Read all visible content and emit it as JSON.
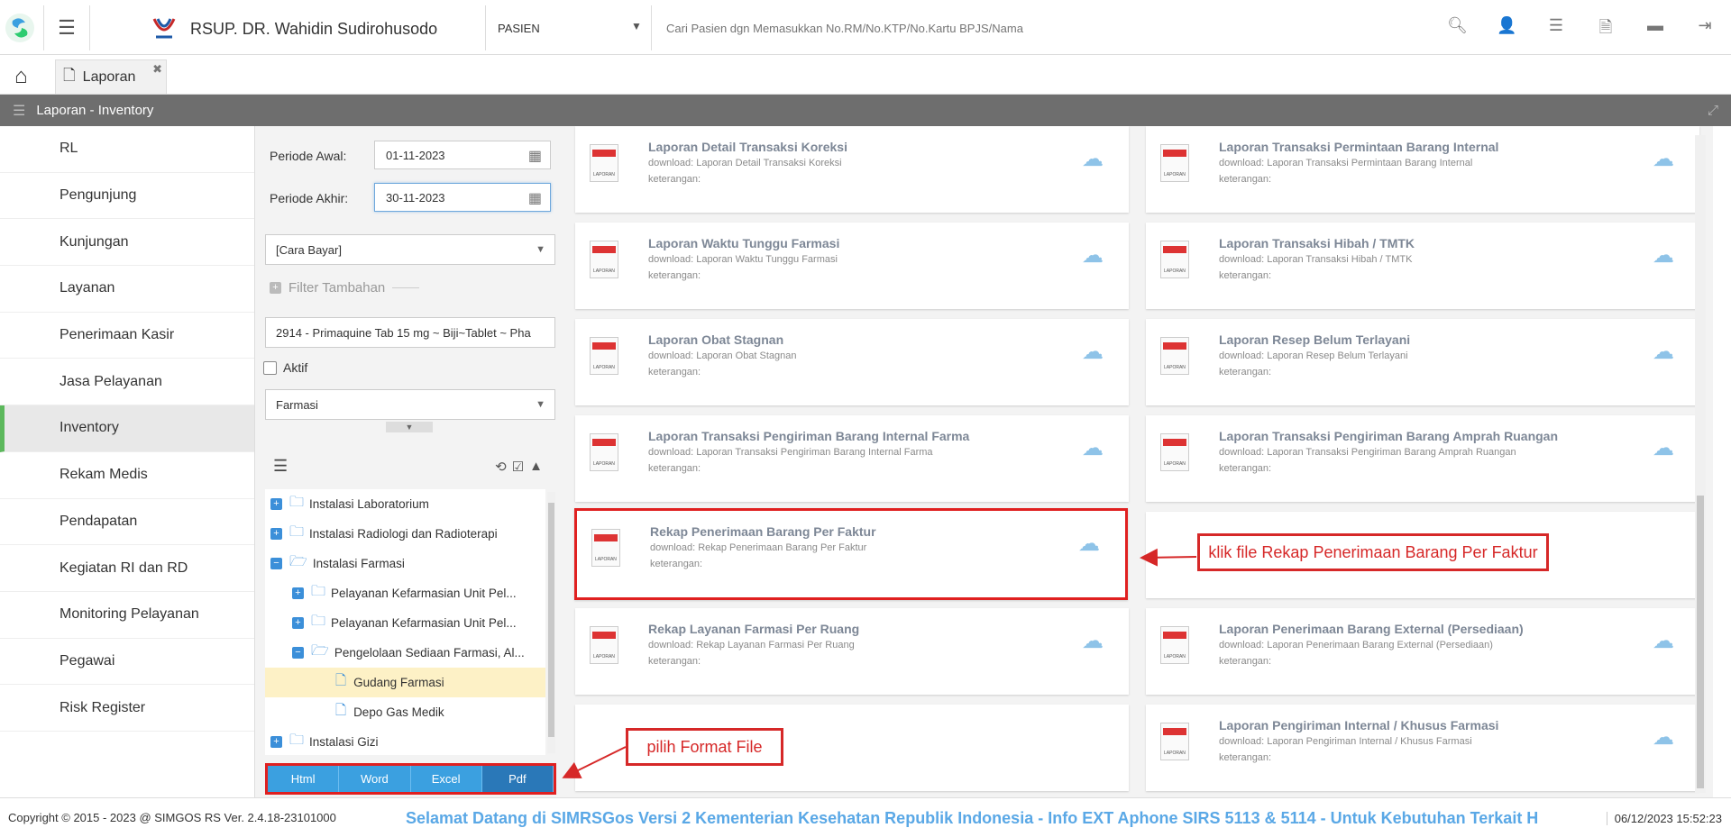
{
  "header": {
    "hospital_name": "RSUP. DR. Wahidin Sudirohusodo",
    "search_category": "PASIEN",
    "search_placeholder": "Cari Pasien dgn Memasukkan No.RM/No.KTP/No.Kartu BPJS/Nama",
    "icons": [
      "search-icon",
      "add-user-icon",
      "list-icon",
      "pdf-file-icon",
      "folder-icon",
      "logout-icon"
    ]
  },
  "tabs": [
    {
      "label": "Laporan"
    }
  ],
  "page_title": "Laporan - Inventory",
  "sidebar": {
    "items": [
      {
        "label": "RL"
      },
      {
        "label": "Pengunjung"
      },
      {
        "label": "Kunjungan"
      },
      {
        "label": "Layanan"
      },
      {
        "label": "Penerimaan Kasir"
      },
      {
        "label": "Jasa Pelayanan"
      },
      {
        "label": "Inventory",
        "active": true
      },
      {
        "label": "Rekam Medis"
      },
      {
        "label": "Pendapatan"
      },
      {
        "label": "Kegiatan RI dan RD"
      },
      {
        "label": "Monitoring Pelayanan"
      },
      {
        "label": "Pegawai"
      },
      {
        "label": "Risk Register"
      }
    ]
  },
  "filters": {
    "periode_awal_label": "Periode Awal:",
    "periode_awal": "01-11-2023",
    "periode_akhir_label": "Periode Akhir:",
    "periode_akhir": "30-11-2023",
    "cara_bayar": "[Cara Bayar]",
    "filter_tambahan": "Filter Tambahan",
    "barang": "2914 - Primaquine Tab 15 mg ~ Biji~Tablet ~ Pha",
    "aktif_label": "Aktif",
    "jenis": "Farmasi"
  },
  "tree": {
    "nodes": [
      {
        "label": "Instalasi Laboratorium"
      },
      {
        "label": "Instalasi Radiologi dan Radioterapi"
      },
      {
        "label": "Instalasi Farmasi"
      },
      {
        "label": "Pelayanan Kefarmasian Unit Pel..."
      },
      {
        "label": "Pelayanan Kefarmasian Unit Pel..."
      },
      {
        "label": "Pengelolaan Sediaan Farmasi, Al..."
      },
      {
        "label": "Gudang Farmasi"
      },
      {
        "label": "Depo Gas Medik"
      },
      {
        "label": "Instalasi Gizi"
      }
    ]
  },
  "formats": [
    "Html",
    "Word",
    "Excel",
    "Pdf"
  ],
  "reports": [
    {
      "title": "Laporan Detail Transaksi Koreksi",
      "download": "download: Laporan Detail Transaksi Koreksi",
      "ket": "keterangan:"
    },
    {
      "title": "Laporan Transaksi Permintaan Barang Internal",
      "download": "download: Laporan Transaksi Permintaan Barang Internal",
      "ket": "keterangan:"
    },
    {
      "title": "Laporan Waktu Tunggu Farmasi",
      "download": "download: Laporan Waktu Tunggu Farmasi",
      "ket": "keterangan:"
    },
    {
      "title": "Laporan Transaksi Hibah / TMTK",
      "download": "download: Laporan Transaksi Hibah / TMTK",
      "ket": "keterangan:"
    },
    {
      "title": "Laporan Obat Stagnan",
      "download": "download: Laporan Obat Stagnan",
      "ket": "keterangan:"
    },
    {
      "title": "Laporan Resep Belum Terlayani",
      "download": "download: Laporan Resep Belum Terlayani",
      "ket": "keterangan:"
    },
    {
      "title": "Laporan Transaksi Pengiriman Barang Internal Farma",
      "download": "download: Laporan Transaksi Pengiriman Barang Internal Farma",
      "ket": "keterangan:"
    },
    {
      "title": "Laporan Transaksi Pengiriman Barang Amprah Ruangan",
      "download": "download: Laporan Transaksi Pengiriman Barang Amprah Ruangan",
      "ket": "keterangan:"
    },
    {
      "title": "Rekap Penerimaan Barang Per Faktur",
      "download": "download: Rekap Penerimaan Barang Per Faktur",
      "ket": "keterangan:"
    },
    {
      "title": "",
      "download": "",
      "ket": ""
    },
    {
      "title": "Rekap Layanan Farmasi Per Ruang",
      "download": "download: Rekap Layanan Farmasi Per Ruang",
      "ket": "keterangan:"
    },
    {
      "title": "Laporan Penerimaan Barang External (Persediaan)",
      "download": "download: Laporan Penerimaan Barang External (Persediaan)",
      "ket": "keterangan:"
    },
    {
      "title": "",
      "download": "",
      "ket": ""
    },
    {
      "title": "Laporan Pengiriman Internal / Khusus Farmasi",
      "download": "download: Laporan Pengiriman Internal / Khusus Farmasi",
      "ket": "keterangan:"
    }
  ],
  "annotations": {
    "rekap": "klik file Rekap Penerimaan Barang Per Faktur",
    "format": "pilih Format File"
  },
  "footer": {
    "copyright": "Copyright © 2015 - 2023 @ SIMGOS RS Ver. 2.4.18-23101000",
    "marquee": "Selamat Datang di SIMRSGos Versi 2 Kementerian Kesehatan Republik Indonesia - Info EXT Aphone SIRS 5113 & 5114 - Untuk Kebutuhan Terkait H",
    "datetime": "06/12/2023 15:52:23"
  },
  "colors": {
    "accent": "#3ba0e0",
    "annotation": "#d62828",
    "active_marker": "#5cb85c"
  }
}
